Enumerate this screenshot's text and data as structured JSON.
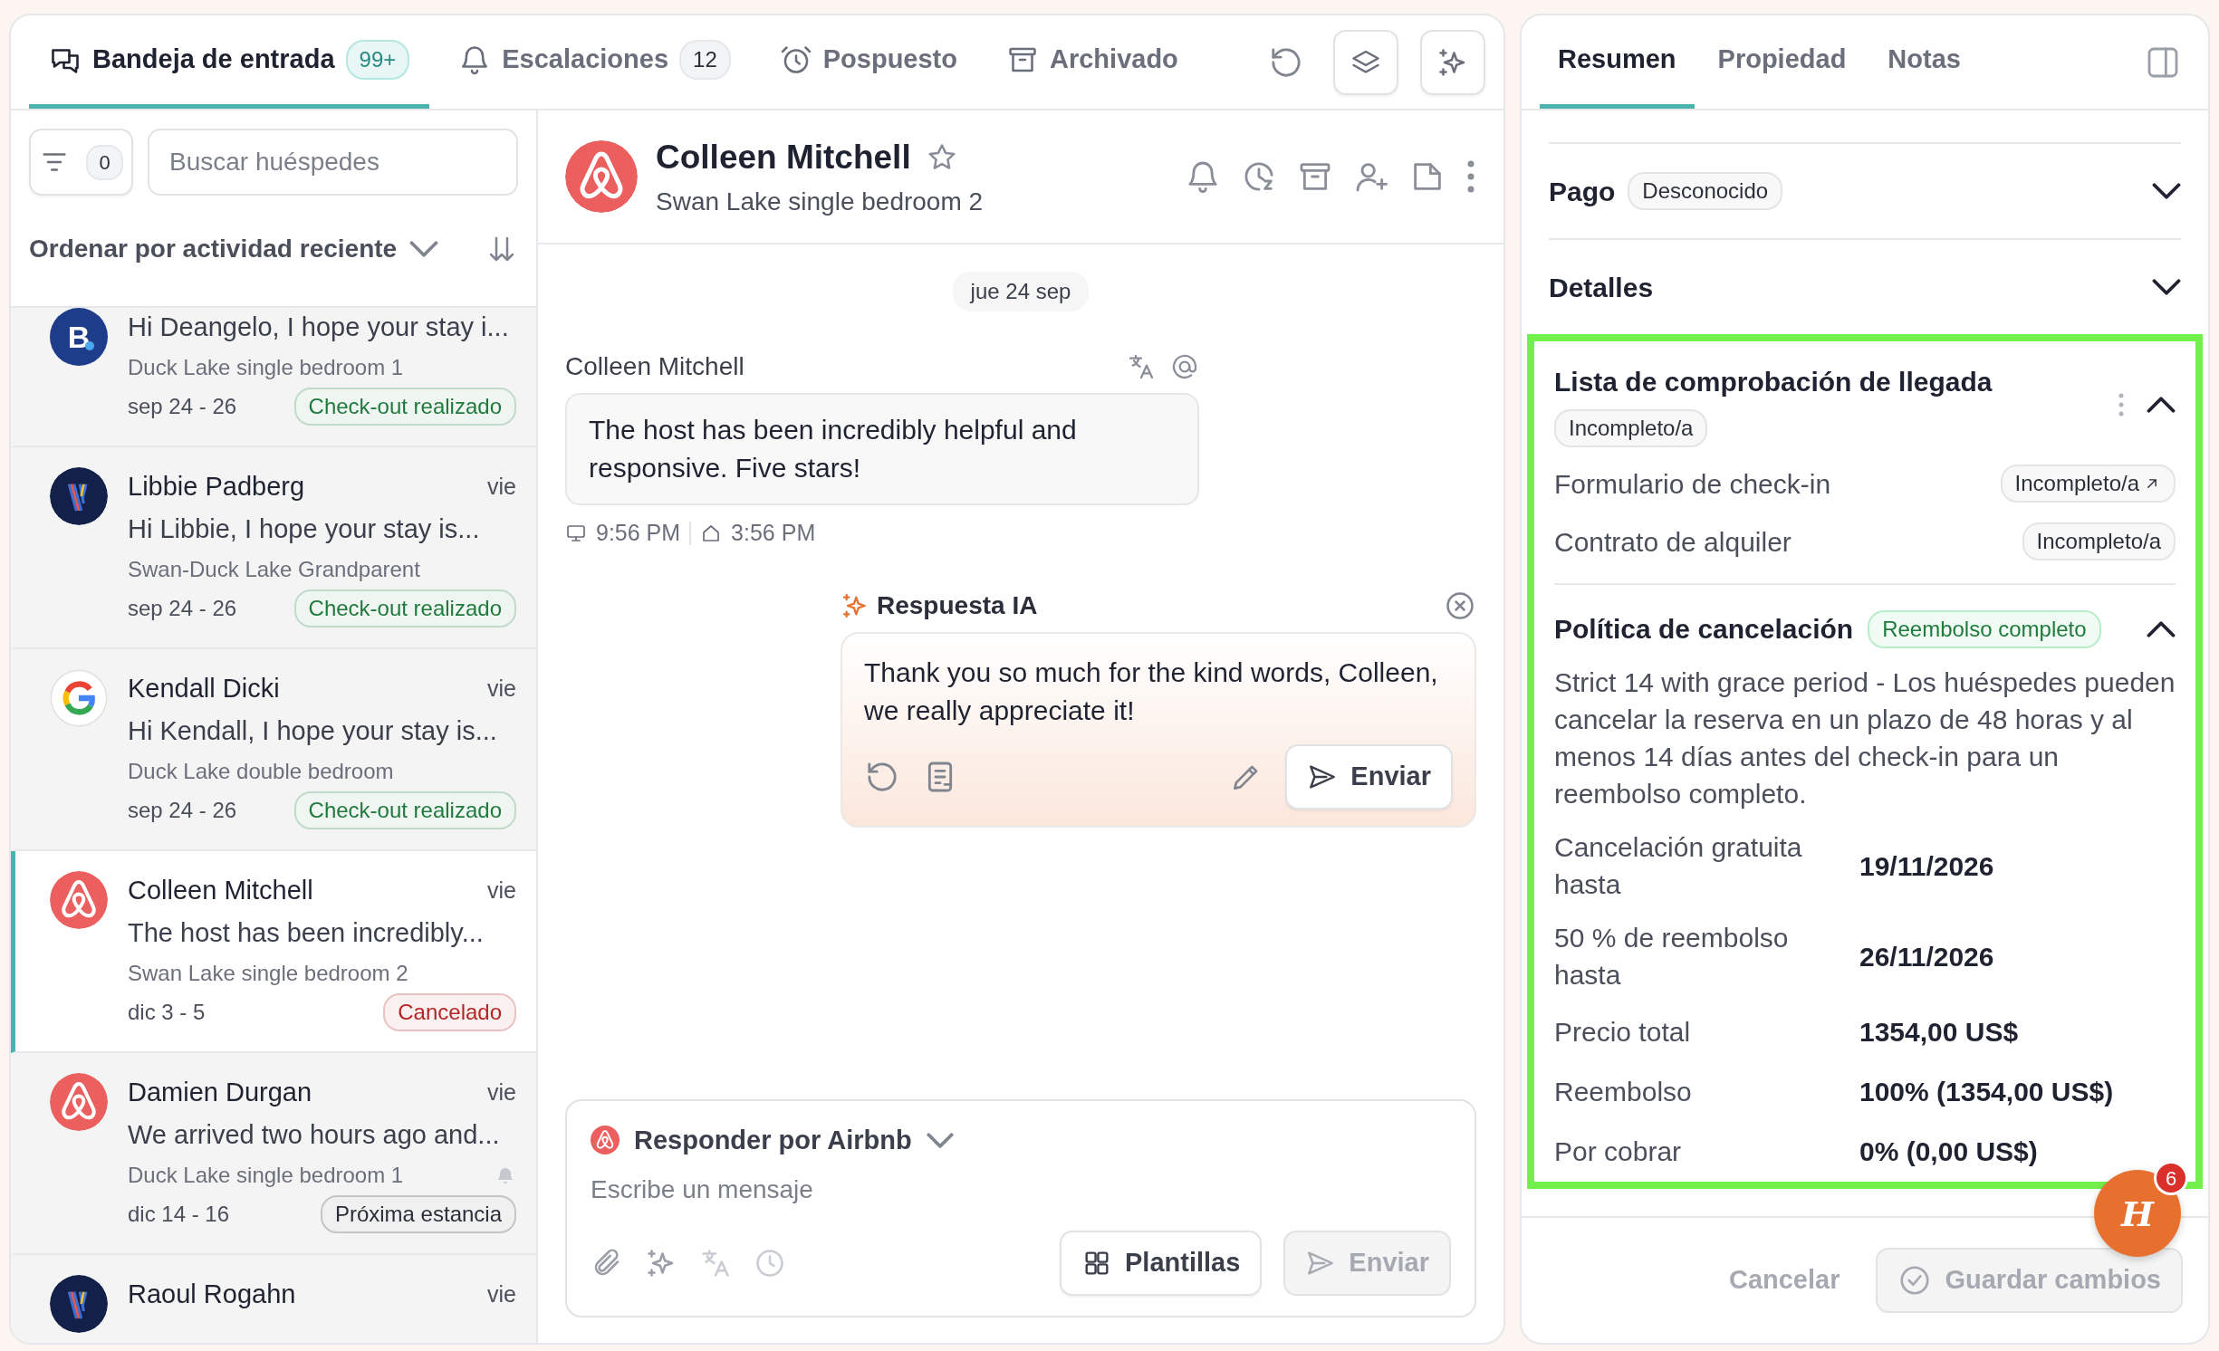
{
  "top_tabs": [
    {
      "label": "Bandeja de entrada",
      "count": "99+",
      "selected": true
    },
    {
      "label": "Escalaciones",
      "count": "12",
      "selected": false
    },
    {
      "label": "Pospuesto",
      "selected": false
    },
    {
      "label": "Archivado",
      "selected": false
    }
  ],
  "filter": {
    "count": "0"
  },
  "search": {
    "placeholder": "Buscar huéspedes"
  },
  "sort": {
    "label": "Ordenar por actividad reciente"
  },
  "conversations": [
    {
      "kind": "booking",
      "avatar_label": "B",
      "preview": "Hi Deangelo, I hope your stay i...",
      "property": "Duck Lake single bedroom 1",
      "dates": "sep 24 - 26",
      "status": "Check-out realizado",
      "color": "#207a3d",
      "selected": false,
      "alert": false
    },
    {
      "kind": "vrbo",
      "name": "Libbie Padberg",
      "time": "vie",
      "preview": "Hi Libbie, I hope your stay is...",
      "property": "Swan-Duck Lake Grandparent",
      "dates": "sep 24 - 26",
      "status": "Check-out realizado",
      "color": "#207a3d",
      "selected": false,
      "alert": false
    },
    {
      "kind": "google",
      "name": "Kendall Dicki",
      "time": "vie",
      "preview": "Hi Kendall, I hope your stay is...",
      "property": "Duck Lake double bedroom",
      "dates": "sep 24 - 26",
      "status": "Check-out realizado",
      "color": "#207a3d",
      "selected": false,
      "alert": false
    },
    {
      "kind": "airbnb",
      "name": "Colleen Mitchell",
      "time": "vie",
      "preview": "The host has been incredibly...",
      "property": "Swan Lake single bedroom 2",
      "dates": "dic 3 - 5",
      "status": "Cancelado",
      "color": "#b62525",
      "selected": true,
      "alert": false
    },
    {
      "kind": "airbnb",
      "name": "Damien Durgan",
      "time": "vie",
      "preview": "We arrived two hours ago and...",
      "property": "Duck Lake single bedroom 1",
      "dates": "dic 14 - 16",
      "status": "Próxima estancia",
      "color": "#2b2f3a",
      "selected": false,
      "alert": true
    },
    {
      "kind": "vrbo",
      "name": "Raoul Rogahn",
      "time": "vie",
      "selected": false
    }
  ],
  "conversation": {
    "name": "Colleen Mitchell",
    "starred": false,
    "property": "Swan Lake single bedroom 2",
    "date": "jue 24 sep",
    "messages": [
      {
        "sender": "Colleen Mitchell",
        "text": "The host has been incredibly helpful and responsive. Five stars!",
        "device_time": "9:56 PM",
        "local_time": "3:56 PM"
      }
    ],
    "ai_reply": {
      "title": "Respuesta IA",
      "text": "Thank you so much for the kind words, Colleen, we really appreciate it!",
      "send": "Enviar"
    },
    "composer": {
      "channel": "Responder por Airbnb",
      "placeholder": "Escribe un mensaje",
      "templates": "Plantillas",
      "send": "Enviar",
      "send_disabled": true
    }
  },
  "details": {
    "tabs": [
      {
        "label": "Resumen",
        "selected": true
      },
      {
        "label": "Propiedad",
        "selected": false
      },
      {
        "label": "Notas",
        "selected": false
      }
    ],
    "sections": [
      {
        "title": "Pago",
        "badge": "Desconocido",
        "expanded": false
      },
      {
        "title": "Detalles",
        "expanded": false
      }
    ],
    "highlighted": true,
    "checklist": {
      "title": "Lista de comprobación de llegada",
      "status": "Incompleto/a",
      "expanded": true,
      "items": [
        {
          "label": "Formulario de check-in",
          "status": "Incompleto/a",
          "link": true
        },
        {
          "label": "Contrato de alquiler",
          "status": "Incompleto/a",
          "link": false
        }
      ]
    },
    "policy": {
      "title": "Política de cancelación",
      "badge": "Reembolso completo",
      "expanded": true,
      "description": "Strict 14 with grace period - Los huéspedes pueden cancelar la reserva en un plazo de 48 horas y al menos 14 días antes del check-in para un reembolso completo.",
      "rows": [
        {
          "label": "Cancelación gratuita hasta",
          "value": "19/11/2026"
        },
        {
          "label": "50 % de reembolso hasta",
          "value": "26/11/2026"
        },
        {
          "label": "Precio total",
          "value": "1354,00 US$"
        },
        {
          "label": "Reembolso",
          "value": "100% (1354,00 US$)"
        },
        {
          "label": "Por cobrar",
          "value": "0% (0,00 US$)"
        }
      ]
    },
    "cancel": "Cancelar",
    "save": "Guardar cambios",
    "save_disabled": true
  },
  "launcher": {
    "label": "H",
    "badge": "6"
  }
}
